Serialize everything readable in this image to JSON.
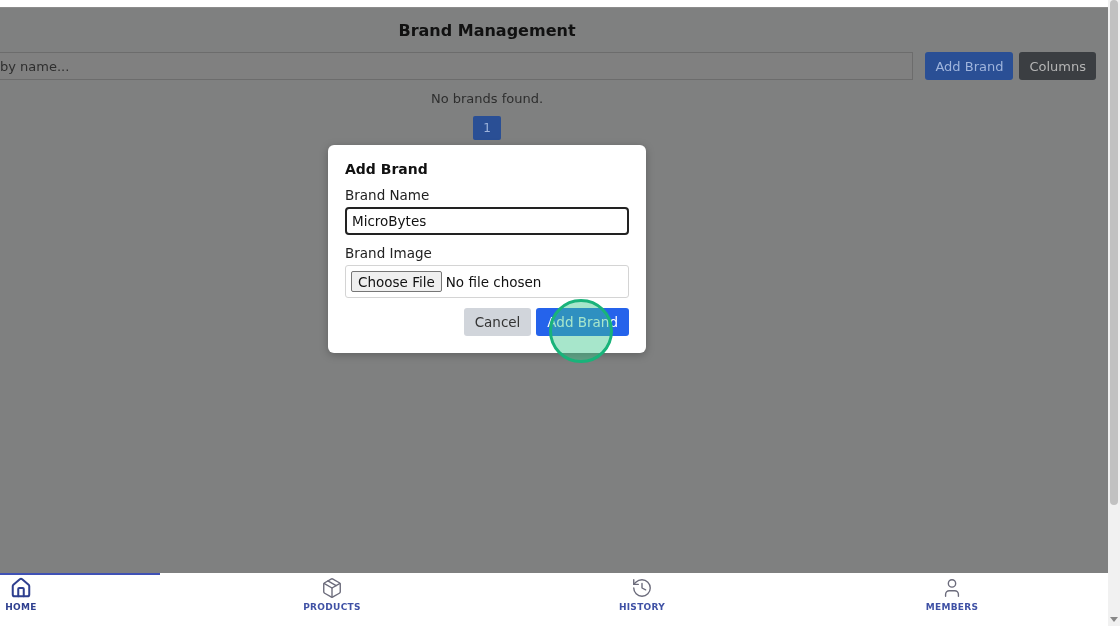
{
  "page": {
    "title": "Brand Management",
    "search": {
      "placeholder": "by name..."
    },
    "buttons": [
      {
        "label": "Add Brand",
        "kind": "primary"
      },
      {
        "label": "Columns",
        "kind": "secondary"
      }
    ],
    "empty_message": "No brands found.",
    "pagination": [
      {
        "label": "1",
        "selected": true
      }
    ]
  },
  "dialog": {
    "title": "Add Brand",
    "fields": [
      {
        "kind": "text",
        "label": "Brand Name",
        "value": "MicroBytes"
      },
      {
        "kind": "file",
        "label": "Brand Image",
        "button": "Choose File",
        "status": "No file chosen"
      }
    ],
    "buttons": [
      {
        "label": "Cancel",
        "kind": "secondary"
      },
      {
        "label": "Add Brand",
        "kind": "primary"
      }
    ]
  },
  "nav": [
    {
      "label": "HOME",
      "kind": "home",
      "selected": true
    },
    {
      "label": "PRODUCTS",
      "kind": "box",
      "selected": false
    },
    {
      "label": "HISTORY",
      "kind": "history",
      "selected": false
    },
    {
      "label": "MEMBERS",
      "kind": "user",
      "selected": false
    }
  ]
}
